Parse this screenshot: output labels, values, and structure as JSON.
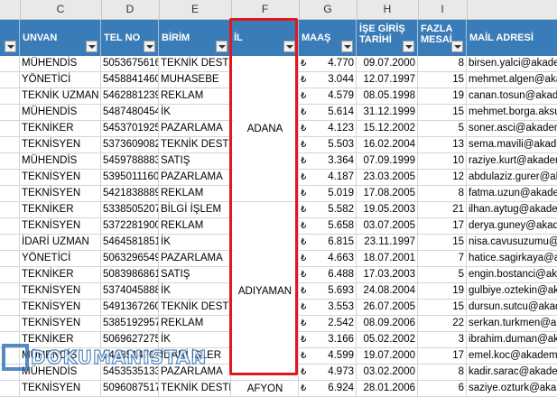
{
  "columns": [
    "C",
    "D",
    "E",
    "F",
    "G",
    "H",
    "I"
  ],
  "headers": {
    "unvan": "UNVAN",
    "telno": "TEL NO",
    "birim": "BİRİM",
    "il": "İL",
    "maas": "MAAŞ",
    "isegiris": [
      "İŞE GİRİŞ",
      "TARİHİ"
    ],
    "fazlamesai": [
      "FAZLA",
      "MESAİ"
    ],
    "mail": "MAİL ADRESİ"
  },
  "currency_symbol": "₺",
  "rows": [
    [
      "MÜHENDİS",
      "5053675616",
      "TEKNİK DESTEK",
      "4.770",
      "09.07.2000",
      "8",
      "birsen.yalci@akade"
    ],
    [
      "YÖNETİCİ",
      "5458841460",
      "MUHASEBE",
      "3.044",
      "12.07.1997",
      "15",
      "mehmet.algen@akad"
    ],
    [
      "TEKNİK UZMAN",
      "5462881239",
      "REKLAM",
      "4.579",
      "08.05.1998",
      "19",
      "canan.tosun@akade"
    ],
    [
      "MÜHENDİS",
      "5487480454",
      "İK",
      "5.614",
      "31.12.1999",
      "15",
      "mehmet.borga.aksu"
    ],
    [
      "TEKNİKER",
      "5453701925",
      "PAZARLAMA",
      "4.123",
      "15.12.2002",
      "5",
      "soner.asci@akadem"
    ],
    [
      "TEKNİSYEN",
      "5373609082",
      "TEKNİK DESTEK",
      "5.503",
      "16.02.2004",
      "13",
      "sema.mavili@akade"
    ],
    [
      "MÜHENDİS",
      "5459788883",
      "SATIŞ",
      "3.364",
      "07.09.1999",
      "10",
      "raziye.kurt@akadem"
    ],
    [
      "TEKNİSYEN",
      "5395011160",
      "PAZARLAMA",
      "4.187",
      "23.03.2005",
      "12",
      "abdulaziz.gurer@ak"
    ],
    [
      "TEKNİSYEN",
      "5421838889",
      "REKLAM",
      "5.019",
      "17.08.2005",
      "8",
      "fatma.uzun@akade"
    ],
    [
      "TEKNİKER",
      "5338505207",
      "BİLGİ İŞLEM",
      "5.582",
      "19.05.2003",
      "21",
      "ilhan.aytug@akade"
    ],
    [
      "TEKNİSYEN",
      "5372281900",
      "REKLAM",
      "5.658",
      "03.07.2005",
      "17",
      "derya.guney@akade"
    ],
    [
      "İDARİ UZMAN",
      "5464581851",
      "İK",
      "6.815",
      "23.11.1997",
      "15",
      "nisa.cavusuzumu@a"
    ],
    [
      "YÖNETİCİ",
      "5063296549",
      "PAZARLAMA",
      "4.663",
      "18.07.2001",
      "7",
      "hatice.sagirkaya@a"
    ],
    [
      "TEKNİKER",
      "5083986861",
      "SATIŞ",
      "6.488",
      "17.03.2003",
      "5",
      "engin.bostanci@aka"
    ],
    [
      "TEKNİSYEN",
      "5374045888",
      "İK",
      "5.693",
      "24.08.2004",
      "19",
      "gulbiye.oztekin@ak"
    ],
    [
      "TEKNİSYEN",
      "5491367260",
      "TEKNİK DESTEK",
      "3.553",
      "26.07.2005",
      "15",
      "dursun.sutcu@akad"
    ],
    [
      "TEKNİSYEN",
      "5385192957",
      "REKLAM",
      "2.542",
      "08.09.2006",
      "22",
      "serkan.turkmen@a"
    ],
    [
      "TEKNİKER",
      "5069627275",
      "İK",
      "3.166",
      "05.02.2002",
      "3",
      "ibrahim.duman@ak"
    ],
    [
      "MÜHENDİS",
      "5428514703",
      "İDARİ İŞLER",
      "4.599",
      "19.07.2000",
      "17",
      "emel.koc@akadem"
    ],
    [
      "MÜHENDİS",
      "5453535133",
      "PAZARLAMA",
      "4.973",
      "03.02.2000",
      "8",
      "kadir.sarac@akade"
    ],
    [
      "TEKNİSYEN",
      "5096087517",
      "TEKNİK DESTEK",
      "6.924",
      "28.01.2006",
      "6",
      "saziye.ozturk@aka"
    ]
  ],
  "il_groups": [
    {
      "name": "ADANA",
      "span": 9
    },
    {
      "name": "ADIYAMAN",
      "span": 11
    },
    {
      "name": "AFYON",
      "span": 1
    }
  ],
  "watermark": "DOKUMANISTAN"
}
